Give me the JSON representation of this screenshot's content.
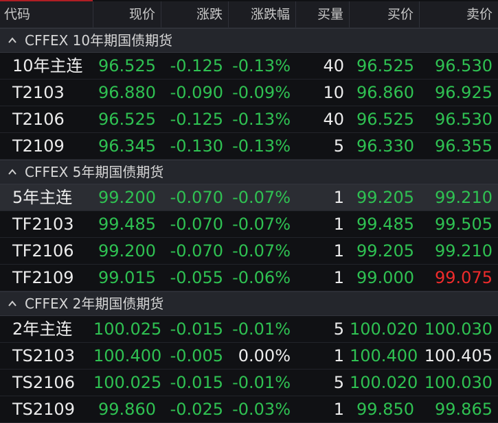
{
  "colors": {
    "up": "#ee2b2b",
    "down": "#2fc152",
    "flat": "#ececec"
  },
  "header": {
    "code": "代码",
    "price": "现价",
    "change": "涨跌",
    "pct": "涨跌幅",
    "qty": "买量",
    "bid": "买价",
    "ask": "卖价"
  },
  "groups": [
    {
      "title": "CFFEX 10年期国债期货",
      "rows": [
        {
          "code": "10年主连",
          "price": "96.525",
          "change": "-0.125",
          "pct": "-0.13%",
          "qty": "40",
          "bid": "96.525",
          "ask": "96.530"
        },
        {
          "code": "T2103",
          "price": "96.880",
          "change": "-0.090",
          "pct": "-0.09%",
          "qty": "10",
          "bid": "96.860",
          "ask": "96.925"
        },
        {
          "code": "T2106",
          "price": "96.525",
          "change": "-0.125",
          "pct": "-0.13%",
          "qty": "40",
          "bid": "96.525",
          "ask": "96.530"
        },
        {
          "code": "T2109",
          "price": "96.345",
          "change": "-0.130",
          "pct": "-0.13%",
          "qty": "5",
          "bid": "96.330",
          "ask": "96.355"
        }
      ]
    },
    {
      "title": "CFFEX 5年期国债期货",
      "rows": [
        {
          "code": "5年主连",
          "price": "99.200",
          "change": "-0.070",
          "pct": "-0.07%",
          "qty": "1",
          "bid": "99.205",
          "ask": "99.210",
          "selected": true
        },
        {
          "code": "TF2103",
          "price": "99.485",
          "change": "-0.070",
          "pct": "-0.07%",
          "qty": "1",
          "bid": "99.485",
          "ask": "99.505"
        },
        {
          "code": "TF2106",
          "price": "99.200",
          "change": "-0.070",
          "pct": "-0.07%",
          "qty": "1",
          "bid": "99.205",
          "ask": "99.210"
        },
        {
          "code": "TF2109",
          "price": "99.015",
          "change": "-0.055",
          "pct": "-0.06%",
          "qty": "1",
          "bid": "99.000",
          "ask": "99.075",
          "ask_color": "red"
        }
      ]
    },
    {
      "title": "CFFEX 2年期国债期货",
      "rows": [
        {
          "code": "2年主连",
          "price": "100.025",
          "change": "-0.015",
          "pct": "-0.01%",
          "qty": "5",
          "bid": "100.020",
          "ask": "100.030"
        },
        {
          "code": "TS2103",
          "price": "100.400",
          "change": "-0.005",
          "pct": "0.00%",
          "pct_color": "white",
          "qty": "1",
          "bid": "100.400",
          "ask": "100.405",
          "ask_color": "white"
        },
        {
          "code": "TS2106",
          "price": "100.025",
          "change": "-0.015",
          "pct": "-0.01%",
          "qty": "5",
          "bid": "100.020",
          "ask": "100.030"
        },
        {
          "code": "TS2109",
          "price": "99.860",
          "change": "-0.025",
          "pct": "-0.03%",
          "qty": "1",
          "bid": "99.850",
          "ask": "99.865"
        }
      ]
    }
  ]
}
